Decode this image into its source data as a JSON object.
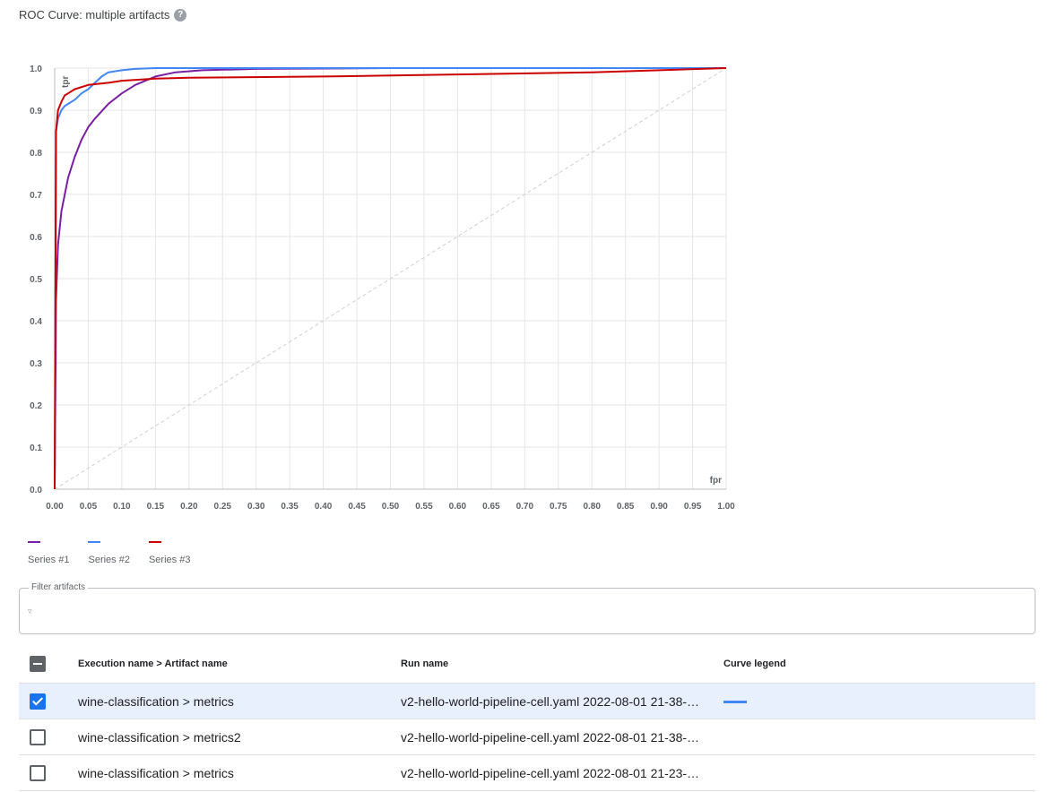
{
  "header": {
    "title": "ROC Curve: multiple artifacts",
    "help_icon": "help-circle-icon",
    "help_glyph": "?"
  },
  "chart_data": {
    "type": "line",
    "xlabel": "fpr",
    "ylabel": "tpr",
    "xlim": [
      0,
      1
    ],
    "ylim": [
      0,
      1
    ],
    "x_ticks": [
      "0.00",
      "0.05",
      "0.10",
      "0.15",
      "0.20",
      "0.25",
      "0.30",
      "0.35",
      "0.40",
      "0.45",
      "0.50",
      "0.55",
      "0.60",
      "0.65",
      "0.70",
      "0.75",
      "0.80",
      "0.85",
      "0.90",
      "0.95",
      "1.00"
    ],
    "y_ticks": [
      "0.0",
      "0.1",
      "0.2",
      "0.3",
      "0.4",
      "0.5",
      "0.6",
      "0.7",
      "0.8",
      "0.9",
      "1.0"
    ],
    "grid": true,
    "legend_position": "bottom-left",
    "diagonal_reference": true,
    "series": [
      {
        "name": "Series #1",
        "color": "#7b1fa2",
        "x": [
          0,
          0.002,
          0.005,
          0.01,
          0.02,
          0.03,
          0.04,
          0.05,
          0.06,
          0.08,
          0.1,
          0.12,
          0.15,
          0.18,
          0.22,
          0.3,
          0.5,
          1.0
        ],
        "y": [
          0,
          0.45,
          0.58,
          0.66,
          0.74,
          0.79,
          0.83,
          0.86,
          0.88,
          0.915,
          0.94,
          0.96,
          0.98,
          0.99,
          0.995,
          0.998,
          1.0,
          1.0
        ]
      },
      {
        "name": "Series #2",
        "color": "#4285f4",
        "x": [
          0,
          0.002,
          0.005,
          0.01,
          0.015,
          0.02,
          0.03,
          0.04,
          0.05,
          0.06,
          0.07,
          0.08,
          0.1,
          0.12,
          0.15,
          0.2,
          1.0
        ],
        "y": [
          0,
          0.85,
          0.88,
          0.9,
          0.91,
          0.915,
          0.925,
          0.94,
          0.95,
          0.965,
          0.98,
          0.99,
          0.995,
          0.998,
          1.0,
          1.0,
          1.0
        ]
      },
      {
        "name": "Series #3",
        "color": "#cc0000",
        "x": [
          0,
          0.002,
          0.005,
          0.01,
          0.015,
          0.02,
          0.03,
          0.05,
          0.08,
          0.1,
          0.15,
          0.2,
          0.4,
          0.6,
          0.8,
          1.0
        ],
        "y": [
          0,
          0.85,
          0.9,
          0.92,
          0.935,
          0.94,
          0.95,
          0.96,
          0.965,
          0.97,
          0.975,
          0.977,
          0.98,
          0.985,
          0.99,
          1.0
        ]
      }
    ]
  },
  "filter": {
    "label": "Filter artifacts",
    "icon": "filter-icon",
    "glyph": "▿",
    "value": ""
  },
  "table": {
    "headers": {
      "artifact": "Execution name > Artifact name",
      "run": "Run name",
      "legend": "Curve legend"
    },
    "rows": [
      {
        "artifact": "wine-classification > metrics",
        "run": "v2-hello-world-pipeline-cell.yaml 2022-08-01 21-38-…",
        "checked": true,
        "legend_color": "#4285f4"
      },
      {
        "artifact": "wine-classification > metrics2",
        "run": "v2-hello-world-pipeline-cell.yaml 2022-08-01 21-38-…",
        "checked": false,
        "legend_color": ""
      },
      {
        "artifact": "wine-classification > metrics",
        "run": "v2-hello-world-pipeline-cell.yaml 2022-08-01 21-23-…",
        "checked": false,
        "legend_color": ""
      }
    ]
  }
}
